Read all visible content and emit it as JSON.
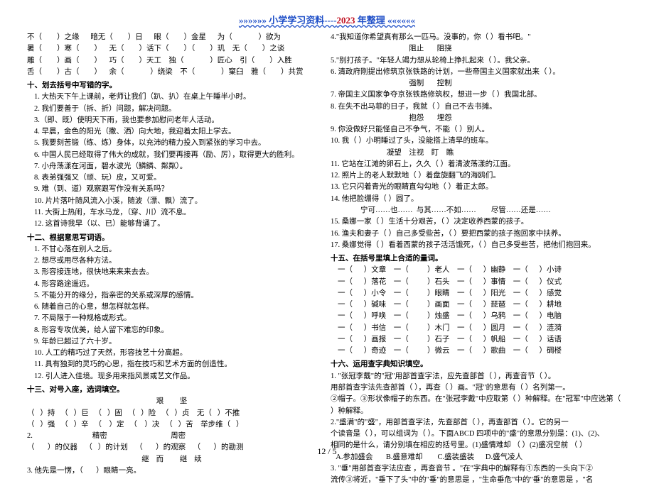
{
  "header": {
    "prefix": "»»»»»» 小学学习资料----",
    "year": "2023",
    "suffix": " 年整理 ««««««"
  },
  "left": {
    "fill_rows": [
      "不（        ）之缘      暗无（        ）日      眼（        ）金星      为（              ）欲为",
      "暑（        ）寒（        ）    无（        ）话下（        ）（        ）玑    无（        ）之谈",
      "雕（        ）画（        ）    巧（        ）天工    独（              ）匠心    引（        ）入胜",
      "舌（        ）古（        ）    余（              ）绕梁    不（              ）窠臼    雅（        ）共赏"
    ],
    "s10_title": "十、划去括号中写错的字。",
    "s10": [
      "1. 大热天下午上课前，老师让我们（趴、扒）在桌上午睡半小时。",
      "2. 我们要善于（拆、折）问题，解决问题。",
      "3.（即、既）使明天下雨，我也要参加慰问老年人活动。",
      "4. 早晨，金色的阳光（撒、洒）向大地，我迎着太阳上学去。",
      "5. 我要刻苦锻（练、炼）身体，以充沛的精力投入到紧张的学习中去。",
      "6. 中国人民已经取得了伟大的成就，我们要再接再（励、厉），取得更大的胜利。",
      "7. 小舟荡漾在河面，碧水波光（鳞鳞、粼粼）。",
      "8. 表弟强强又（顽、玩）皮，又可爱。",
      "9. 难（到、道）观察跟写作没有关系吗？",
      "10. 片片落叶随风流入小溪，随波（漂、飘）流了。",
      "11. 大街上热闹，车水马龙，（穿、川）流不息。",
      "12. 这首诗我早（以、已）能够背诵了。"
    ],
    "s12_title": "十二、根据意思写词语。",
    "s12": [
      "1. 不甘心落在别人之后。",
      "2. 想尽或用尽各种方法。",
      "3. 形容接连地，很快地来来来去去。",
      "4. 形容路途遥远。",
      "5. 不能分开的缘分，指亲密的关系或深厚的感情。",
      "6. 随着自己的心意，想怎样就怎样。",
      "7. 不局限于一种规格或形式。",
      "8. 形容专攻优美，给人留下难忘的印象。",
      "9. 年龄已超过了六十岁。",
      "10. 人工的精巧过了天然，形容技艺十分高超。",
      "11. 具有独到的灵巧的心思，指在技巧和艺术方面的创造性。",
      "12. 引人进入佳境。现多用来指风景或艺文作品。"
    ],
    "s13_title": "十三、对号入座，选词填空。",
    "s13_words1": "艰              坚",
    "s13_line1": "（   ）持   （   ）巨   （   ）固   （   ）险   （   ）贞    无（   ）不推",
    "s13_line2": "（   ）强   （   ）辛   （    ）定   （    ）决   （   ）苦    举步维（   ）",
    "s13_part2": "2.                                精密                                  周密",
    "s13_line3": "（       ）的仪器    （   ）的计划    （       ）的观察    （       ）的勘测",
    "s13_words2": "继而       继续",
    "s13_line4": "3. 他先是一愣，（       ）眼睛一亮。"
  },
  "right": {
    "intro": [
      "4.\"我知道你希望真有那么一匹马。没事的，你（       ）看书吧。\"",
      "                                          阻止       阻挠",
      "5.\"别打孩子。\"年轻人竭力想从轮椅上挣扎起来（   ）。我父亲。",
      "6. 清政府刚提出修筑京张铁路的计划，一些帝国主义国家就出来（    ）。",
      "                                          强制       控制",
      "7. 帝国主义国家争夺京张铁路修筑权，想进一步（    ）我国北部。",
      "8. 在失不出马菲的日子，我就（       ）自己不去书摊。",
      "                                          抱怨       埋怨",
      "9. 你没做好只能怪自己不争气，不能（       ）别人。",
      "10. 我（    ）小明睡过了头，没能搭上清早的班车。",
      "                              凝望    注视    盯    瞧",
      "11. 它站在江滩的卵石上，久久（     ）着清波荡漾的江面。",
      "12. 照片上的老人默默地（       ）着盘旋翻飞的海鸥们。",
      "13. 它只闪着青光的眼睛直勾勾地（     ）着正太郎。",
      "14. 他把脸绷得（      ）圆了。",
      "                宁可……也……  与其……不如……        尽管……还是……",
      "15. 桑娜一家（     ）生活十分艰苦，（     ）决定收养西蒙的孩子。",
      "16. 渔夫和妻子（    ）自己多受些苦，（     ）要把西蒙的孩子抱回家中扶养。",
      "17. 桑娜觉得（    ）看着西蒙的孩子活活饿死，（    ）自己多受些苦，把他们抱回来。"
    ],
    "s15_title": "十五、在括号里填上合适的量词。",
    "s15": [
      "一（      ）文章    一（          ）老人    一（      ）幽静    一（      ）小诗",
      "一（      ）落花    一（          ）石头    一（      ）事情    一（      ）仪式",
      "一（      ）小令    一（          ）眼睛    一（      ）阳光    一（      ）感觉",
      "一（      ）碱味    一（          ）画面    一（      ）琵琶    一（      ）耕地",
      "一（      ）呼唤    一（          ）烛盛    一（      ）乌鸦    一（      ）电脑",
      "一（      ）书信    一（          ）木门    一（      ）圆月    一（      ）涟漪",
      "一（      ）画报    一（          ）石子    一（      ）帆船    一（      ）话语",
      "一（      ）奇迹    一（          ）微云    一（      ）歌曲    一（      ）碉楼"
    ],
    "s16_title": "十六、运用查字典知识填空。",
    "s16": [
      "   1. \"张冠李戴\"的\"冠\"用部首查字法，应先查部首（     ），再查音节（     ）。",
      "用部首查字法先查部首（     ），再查（     ）画。\"冠\"的意思有（    ）名列第一。",
      "②帽子。③形状像帽子的东西。在\"张冠李戴\"中应取第（     ）种解释。在\"冠军\"中应选第（",
      "  ）种解释。",
      "2.\"盛满\"的\"盛\"，用部首查字法，先查部首（      ），再查部首（      ）。它的另一",
      "个读音是（     ），可以组词为（     ）。下面ABCD 四项中的\"盛\"的意思分别是：(1)、(2)、",
      "相同的是什么，请分别填在相应的括号里。(1)盛情难却   （           ）(2)盛况空前    （           ）",
      "   A.参加盛会       B.盛意难却        C.盛装盛装      D.盛气凌人",
      "3.     \"垂\"用部首查字法应查     ，再查音节   。\"在\"字典中的解释有①东西的一头向下②",
      "流传③将近，\"垂下了头\"中的\"垂\"的意思是    ，\"生命垂危\"中的\"垂\"的意思是    ，\"名"
    ]
  },
  "pageno": "12 / 5"
}
